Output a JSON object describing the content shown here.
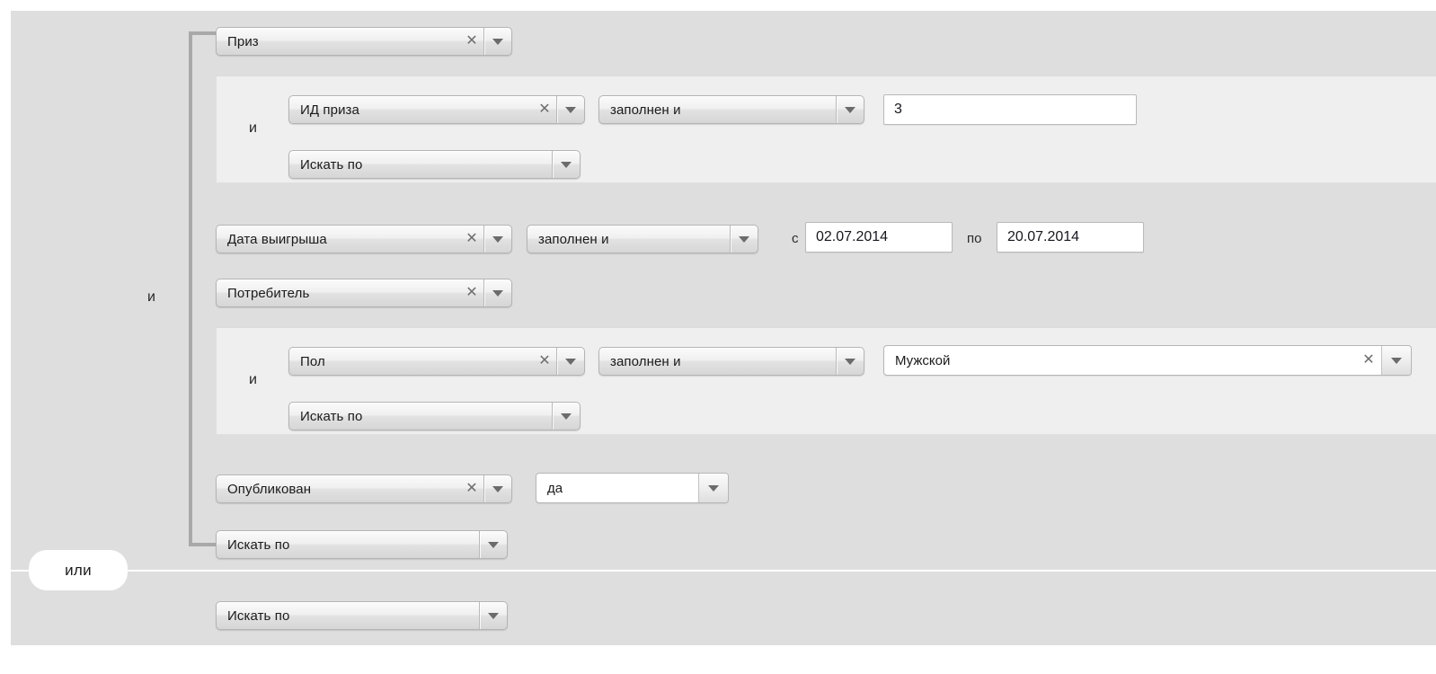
{
  "theme": {
    "page_bg": "#ffffff",
    "container_bg": "#dededf",
    "subpanel_bg": "#efefef",
    "bracket_color": "#a9a9a9",
    "text_color": "#1b1b1b",
    "input_bg": "#ffffff"
  },
  "icons": {
    "clear": "✕",
    "chevron_down": "chevron-down-icon"
  },
  "operators": {
    "and": "и",
    "or": "или"
  },
  "group": {
    "root_operator": "и",
    "rows": {
      "prize": {
        "field_label": "Приз",
        "sub_operator": "и",
        "sub_rows": {
          "prize_id": {
            "field_label": "ИД приза",
            "condition_label": "заполнен и",
            "value": "3"
          },
          "add_row": {
            "field_label": "Искать по"
          }
        }
      },
      "win_date": {
        "field_label": "Дата выигрыша",
        "condition_label": "заполнен и",
        "from_prefix": "с",
        "from_value": "02.07.2014",
        "to_prefix": "по",
        "to_value": "20.07.2014"
      },
      "consumer": {
        "field_label": "Потребитель",
        "sub_operator": "и",
        "sub_rows": {
          "gender": {
            "field_label": "Пол",
            "condition_label": "заполнен и",
            "value": "Мужской"
          },
          "add_row": {
            "field_label": "Искать по"
          }
        }
      },
      "published": {
        "field_label": "Опубликован",
        "value": "да"
      },
      "add_row": {
        "field_label": "Искать по"
      }
    }
  },
  "second_group": {
    "add_row": {
      "field_label": "Искать по"
    }
  }
}
